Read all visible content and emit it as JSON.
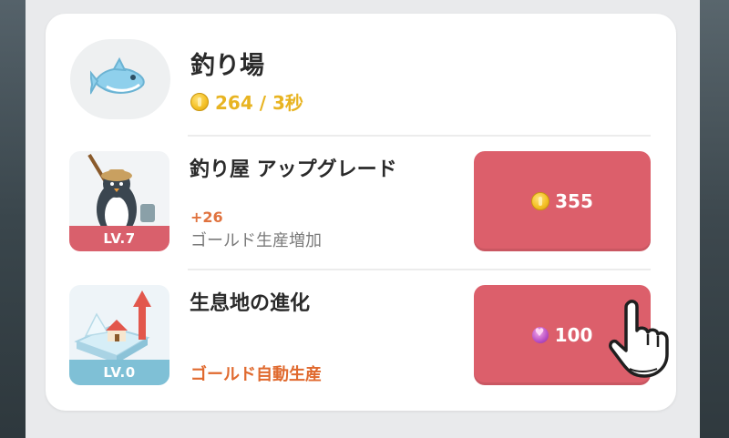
{
  "header": {
    "title": "釣り場",
    "rate_text": "264 / 3秒",
    "icon": "fish-icon"
  },
  "items": [
    {
      "title": "釣り屋 アップグレード",
      "level": "LV.7",
      "bonus": "+26",
      "description": "ゴールド生産増加",
      "price": "355",
      "currency": "coin-icon",
      "icon": "penguin-fisher-icon"
    },
    {
      "title": "生息地の進化",
      "level": "LV.0",
      "description": "ゴールド自動生産",
      "price": "100",
      "currency": "gem-icon",
      "icon": "island-evolve-icon"
    }
  ],
  "colors": {
    "button": "#dc5f6b",
    "level_red": "#d9606c",
    "level_blue": "#7fc0d6",
    "gold": "#e8b422",
    "orange": "#e06a2f"
  }
}
